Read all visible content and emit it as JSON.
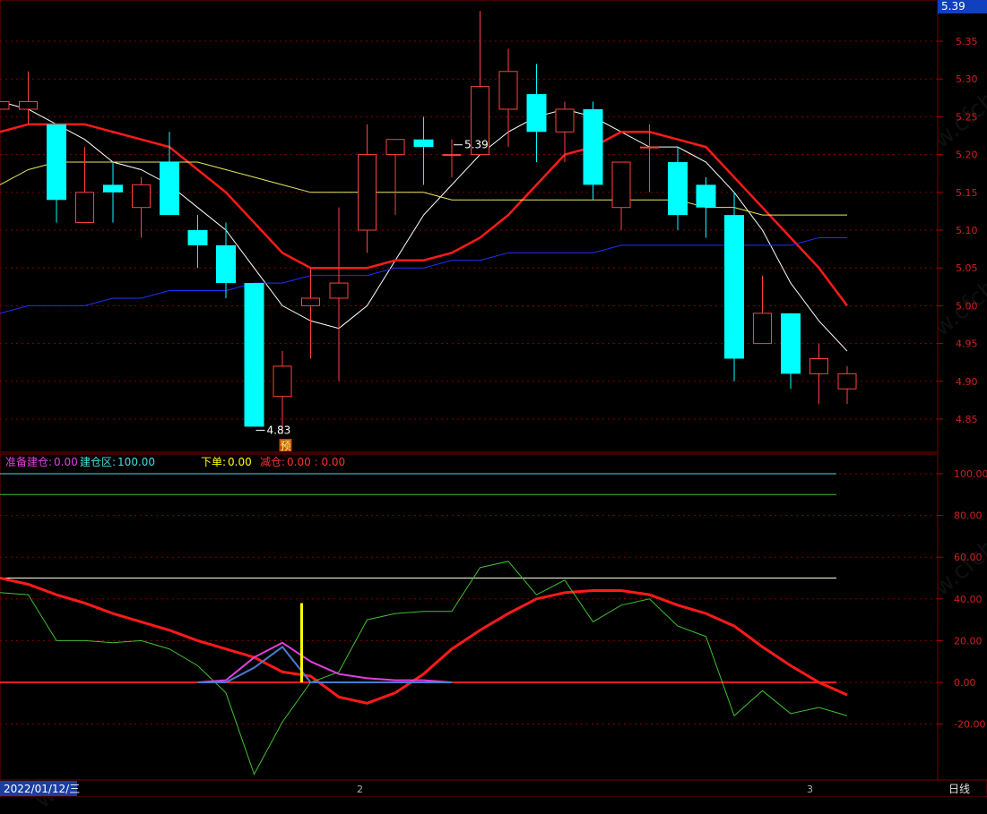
{
  "watermark": "www.cfchi.com",
  "top_price_tag": "5.39",
  "date_label": "2022/01/12/三",
  "period_label": "日线",
  "month_markers": [
    "2",
    "3"
  ],
  "indicator_legend": [
    {
      "label": "准备建仓:",
      "value": "0.00",
      "color": "#e040e0"
    },
    {
      "label": "建仓区:",
      "value": "100.00",
      "color": "#40e0e0"
    },
    {
      "label": "下单:",
      "value": "0.00",
      "color": "#ffff00"
    },
    {
      "label": "减仓:",
      "value": "0.00 : 0.00",
      "color": "#ff3030"
    }
  ],
  "marker_char": "预",
  "chart_data": [
    {
      "type": "candlestick",
      "y_ticks": [
        "5.35",
        "5.30",
        "5.25",
        "5.20",
        "5.15",
        "5.10",
        "5.05",
        "5.00",
        "4.95",
        "4.90",
        "4.85"
      ],
      "ylim": [
        4.8,
        5.4
      ],
      "annotations": [
        {
          "text": "5.39",
          "x_index": 16
        },
        {
          "text": "4.83",
          "x_index": 9
        }
      ],
      "candles": [
        {
          "o": 5.26,
          "h": 5.27,
          "l": 5.26,
          "c": 5.27
        },
        {
          "o": 5.26,
          "h": 5.31,
          "l": 5.24,
          "c": 5.27
        },
        {
          "o": 5.24,
          "h": 5.24,
          "l": 5.11,
          "c": 5.14
        },
        {
          "o": 5.11,
          "h": 5.21,
          "l": 5.11,
          "c": 5.15
        },
        {
          "o": 5.16,
          "h": 5.19,
          "l": 5.11,
          "c": 5.15
        },
        {
          "o": 5.13,
          "h": 5.17,
          "l": 5.09,
          "c": 5.16
        },
        {
          "o": 5.19,
          "h": 5.23,
          "l": 5.12,
          "c": 5.12
        },
        {
          "o": 5.1,
          "h": 5.12,
          "l": 5.05,
          "c": 5.08
        },
        {
          "o": 5.08,
          "h": 5.11,
          "l": 5.01,
          "c": 5.03
        },
        {
          "o": 5.03,
          "h": 5.03,
          "l": 4.84,
          "c": 4.84
        },
        {
          "o": 4.88,
          "h": 4.94,
          "l": 4.83,
          "c": 4.92
        },
        {
          "o": 5.0,
          "h": 5.05,
          "l": 4.93,
          "c": 5.01
        },
        {
          "o": 5.01,
          "h": 5.13,
          "l": 4.9,
          "c": 5.03
        },
        {
          "o": 5.1,
          "h": 5.24,
          "l": 5.07,
          "c": 5.2
        },
        {
          "o": 5.2,
          "h": 5.22,
          "l": 5.12,
          "c": 5.22
        },
        {
          "o": 5.22,
          "h": 5.25,
          "l": 5.16,
          "c": 5.21
        },
        {
          "o": 5.2,
          "h": 5.22,
          "l": 5.17,
          "c": 5.2
        },
        {
          "o": 5.2,
          "h": 5.39,
          "l": 5.2,
          "c": 5.29
        },
        {
          "o": 5.26,
          "h": 5.34,
          "l": 5.21,
          "c": 5.31
        },
        {
          "o": 5.28,
          "h": 5.32,
          "l": 5.19,
          "c": 5.23
        },
        {
          "o": 5.23,
          "h": 5.27,
          "l": 5.19,
          "c": 5.26
        },
        {
          "o": 5.26,
          "h": 5.27,
          "l": 5.14,
          "c": 5.16
        },
        {
          "o": 5.13,
          "h": 5.19,
          "l": 5.1,
          "c": 5.19
        },
        {
          "o": 5.21,
          "h": 5.24,
          "l": 5.15,
          "c": 5.21
        },
        {
          "o": 5.19,
          "h": 5.21,
          "l": 5.1,
          "c": 5.12
        },
        {
          "o": 5.16,
          "h": 5.17,
          "l": 5.09,
          "c": 5.13
        },
        {
          "o": 5.12,
          "h": 5.15,
          "l": 4.9,
          "c": 4.93
        },
        {
          "o": 4.95,
          "h": 5.04,
          "l": 4.95,
          "c": 4.99
        },
        {
          "o": 4.99,
          "h": 4.99,
          "l": 4.89,
          "c": 4.91
        },
        {
          "o": 4.91,
          "h": 4.95,
          "l": 4.87,
          "c": 4.93
        },
        {
          "o": 4.89,
          "h": 4.92,
          "l": 4.87,
          "c": 4.91
        }
      ],
      "series": [
        {
          "color": "#ffffff",
          "values": [
            5.27,
            5.26,
            5.24,
            5.22,
            5.19,
            5.18,
            5.16,
            5.13,
            5.1,
            5.05,
            5.0,
            4.98,
            4.97,
            5.0,
            5.06,
            5.12,
            5.16,
            5.2,
            5.23,
            5.25,
            5.26,
            5.25,
            5.23,
            5.21,
            5.21,
            5.19,
            5.15,
            5.1,
            5.03,
            4.98,
            4.94
          ]
        },
        {
          "color": "#ff1a1a",
          "values": [
            5.23,
            5.24,
            5.24,
            5.24,
            5.23,
            5.22,
            5.21,
            5.18,
            5.15,
            5.11,
            5.07,
            5.05,
            5.05,
            5.05,
            5.06,
            5.06,
            5.07,
            5.09,
            5.12,
            5.16,
            5.2,
            5.21,
            5.23,
            5.23,
            5.22,
            5.21,
            5.17,
            5.13,
            5.09,
            5.05,
            5.0
          ]
        },
        {
          "color": "#e8e860",
          "values": [
            5.16,
            5.18,
            5.19,
            5.19,
            5.19,
            5.19,
            5.19,
            5.19,
            5.18,
            5.17,
            5.16,
            5.15,
            5.15,
            5.15,
            5.15,
            5.15,
            5.14,
            5.14,
            5.14,
            5.14,
            5.14,
            5.14,
            5.14,
            5.14,
            5.14,
            5.13,
            5.13,
            5.12,
            5.12,
            5.12,
            5.12
          ]
        },
        {
          "color": "#2030ff",
          "values": [
            4.99,
            5.0,
            5.0,
            5.0,
            5.01,
            5.01,
            5.02,
            5.02,
            5.02,
            5.03,
            5.03,
            5.04,
            5.04,
            5.04,
            5.05,
            5.05,
            5.06,
            5.06,
            5.07,
            5.07,
            5.07,
            5.07,
            5.08,
            5.08,
            5.08,
            5.08,
            5.08,
            5.08,
            5.08,
            5.09,
            5.09
          ]
        }
      ]
    },
    {
      "type": "line",
      "y_ticks": [
        "100.00",
        "80.00",
        "60.00",
        "40.00",
        "20.00",
        "0.00",
        "-20.00"
      ],
      "ylim": [
        -26,
        104
      ],
      "series": [
        {
          "color": "#ff1a1a",
          "values": [
            50,
            47,
            42,
            38,
            33,
            29,
            25,
            20,
            16,
            12,
            5,
            3,
            -7,
            -10,
            -5,
            4,
            16,
            25,
            33,
            40,
            43,
            44,
            44,
            42,
            37,
            33,
            27,
            17,
            8,
            0,
            -6
          ]
        },
        {
          "color": "#40c030",
          "values": [
            43,
            42,
            20,
            20,
            19,
            20,
            16,
            8,
            -5,
            -44,
            -19,
            0,
            5,
            30,
            33,
            34,
            34,
            55,
            58,
            42,
            49,
            29,
            37,
            40,
            27,
            22,
            -16,
            -4,
            -15,
            -12,
            -16
          ]
        },
        {
          "color": "#e040e0",
          "values": [
            0,
            0,
            0,
            0,
            0,
            0,
            0,
            0,
            1,
            12,
            19,
            10,
            4,
            2,
            1,
            1,
            0,
            0,
            0,
            0,
            0,
            0,
            0,
            0,
            0,
            0,
            0,
            0,
            0,
            0,
            0
          ]
        },
        {
          "color": "#4a7bd1",
          "values": [
            0,
            0,
            0,
            0,
            0,
            0,
            0,
            0,
            0,
            7,
            17,
            0,
            0,
            0,
            0,
            0,
            0,
            0,
            0,
            0,
            0,
            0,
            0,
            0,
            0,
            0,
            0,
            0,
            0,
            0,
            0
          ]
        }
      ],
      "hlines": [
        {
          "value": 100,
          "color": "#40e0e0"
        },
        {
          "value": 90,
          "color": "#40c030"
        },
        {
          "value": 50,
          "color": "#ffffe0"
        },
        {
          "value": 0,
          "color": "#ff1a1a"
        }
      ],
      "spike": {
        "x_index": 11,
        "value": 38,
        "color": "#ffff00"
      }
    }
  ]
}
